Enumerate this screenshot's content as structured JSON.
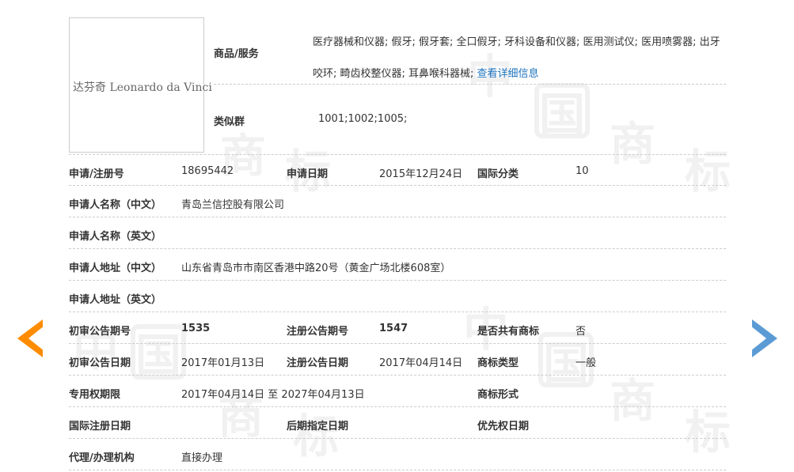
{
  "colors": {
    "accent_orange": "#ff8c00",
    "accent_blue": "#5b9bd5",
    "link": "#1e73be"
  },
  "watermark": [
    "中",
    "国",
    "商",
    "标"
  ],
  "logo": {
    "text": "达芬奇 Leonardo da Vinci"
  },
  "goods": {
    "label": "商品/服务",
    "text": "医疗器械和仪器; 假牙; 假牙套; 全口假牙; 牙科设备和仪器; 医用测试仪; 医用喷雾器; 出牙咬环; 畸齿校整仪器; 耳鼻喉科器械;",
    "link": "查看详细信息"
  },
  "similar_group": {
    "label": "类似群",
    "value": "1001;1002;1005;"
  },
  "rows": [
    {
      "l1": "申请/注册号",
      "v1": "18695442",
      "l2": "申请日期",
      "v2": "2015年12月24日",
      "l3": "国际分类",
      "v3": "10"
    },
    {
      "l1": "申请人名称（中文）",
      "v1": "青岛兰信控股有限公司"
    },
    {
      "l1": "申请人名称（英文）",
      "v1": ""
    },
    {
      "l1": "申请人地址（中文）",
      "v1": "山东省青岛市市南区香港中路20号（黄金广场北楼608室）"
    },
    {
      "l1": "申请人地址（英文）",
      "v1": ""
    },
    {
      "l1": "初审公告期号",
      "v1": "1535",
      "l2": "注册公告期号",
      "v2": "1547",
      "l3": "是否共有商标",
      "v3": "否"
    },
    {
      "l1": "初审公告日期",
      "v1": "2017年01月13日",
      "l2": "注册公告日期",
      "v2": "2017年04月14日",
      "l3": "商标类型",
      "v3": "一般"
    },
    {
      "l1": "专用权期限",
      "v1": "2017年04月14日 至 2027年04月13日",
      "l3": "商标形式",
      "v3": ""
    },
    {
      "l1": "国际注册日期",
      "v1": "",
      "l2": "后期指定日期",
      "v2": "",
      "l3": "优先权日期",
      "v3": ""
    },
    {
      "l1": "代理/办理机构",
      "v1": "直接办理"
    }
  ]
}
